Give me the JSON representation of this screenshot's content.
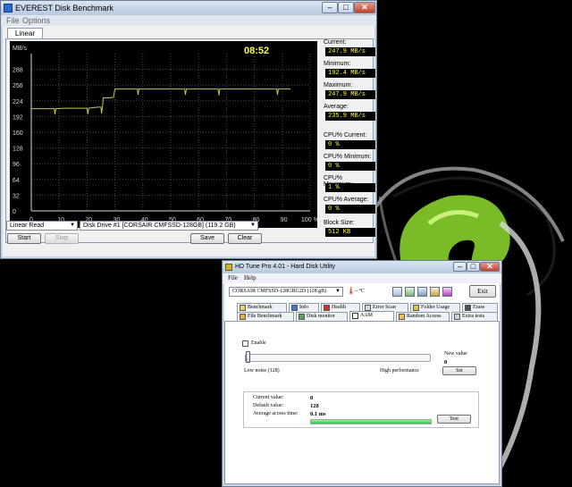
{
  "colors": {
    "desktop": "#000000",
    "chart_bg": "#000000",
    "grid": "#2e5a2e",
    "axis": "#d8d8d8",
    "trace": "#c8c84a",
    "clock": "#ffff40",
    "value_text": "#ffff40",
    "aam_progress": "#2fbf3a",
    "ornament_green": "#7fc62a"
  },
  "everest": {
    "title": "EVEREST Disk Benchmark",
    "menu": [
      "File",
      "Options"
    ],
    "tab": "Linear Read",
    "clock": "08:52",
    "stats": [
      {
        "label": "Current:",
        "value": "247.9 MB/s"
      },
      {
        "label": "Minimum:",
        "value": "192.4 MB/s"
      },
      {
        "label": "Maximum:",
        "value": "247.9 MB/s"
      },
      {
        "label": "Average:",
        "value": "235.9 MB/s"
      },
      {
        "label": "CPU% Current:",
        "value": "0 %"
      },
      {
        "label": "CPU% Minimum:",
        "value": "0 %"
      },
      {
        "label": "CPU% Maximum:",
        "value": "1 %"
      },
      {
        "label": "CPU% Average:",
        "value": "0 %"
      },
      {
        "label": "Block Size:",
        "value": "512 KB"
      }
    ],
    "test_select": "Linear Read",
    "drive_select": "Disk Drive #1  [CORSAIR CMFSSD-128GB]  (119.2 GB)",
    "buttons": {
      "start": "Start",
      "stop": "Stop",
      "save": "Save",
      "clear": "Clear"
    },
    "window_icons": [
      "minimize-icon",
      "maximize-icon",
      "close-icon"
    ]
  },
  "chart_data": {
    "type": "line",
    "title": "",
    "ylabel": "MB/s",
    "xlabel": "",
    "y_ticks": [
      "0",
      "32",
      "64",
      "96",
      "128",
      "160",
      "192",
      "224",
      "256",
      "288"
    ],
    "x_ticks": [
      "0",
      "10",
      "20",
      "30",
      "40",
      "50",
      "60",
      "70",
      "80",
      "90",
      "100 %"
    ],
    "ylim": [
      0,
      320
    ],
    "xlim": [
      0,
      100
    ],
    "grid": true,
    "series": [
      {
        "x": [
          0,
          5,
          8.2,
          8.5,
          8.8,
          12,
          17,
          20,
          20.3,
          20.6,
          22,
          24,
          25,
          25.2,
          25.5,
          25.8,
          26.5,
          28,
          29.5,
          30,
          32,
          35,
          37,
          38,
          38.3,
          38.6,
          45,
          50,
          55,
          55.3,
          55.6,
          60,
          65,
          67,
          67.3,
          67.6,
          75,
          80,
          85,
          88,
          88.3,
          88.6,
          91,
          93
        ],
        "y": [
          208,
          208,
          208,
          196,
          208,
          209,
          209,
          209,
          197,
          209,
          210,
          211,
          211,
          198,
          210,
          230,
          230,
          230,
          231,
          248,
          248,
          248,
          248,
          248,
          236,
          248,
          248,
          248,
          248,
          236,
          248,
          248,
          248,
          248,
          235,
          248,
          248,
          248,
          248,
          248,
          236,
          248,
          248,
          248
        ]
      }
    ]
  },
  "hdtune": {
    "title": "HD Tune Pro 4.01 - Hard Disk Utility",
    "menu": [
      "File",
      "Help"
    ],
    "drive_select": "CORSAIR CMFSSD-128GBG2D (128 gB)",
    "temperature": "– °C",
    "exit": "Exit",
    "toolbar_icons": [
      "copy-icon",
      "save-icon",
      "info-icon",
      "settings-icon",
      "download-icon"
    ],
    "tabs_row1": [
      {
        "label": "Benchmark",
        "icon": "benchmark-icon"
      },
      {
        "label": "Info",
        "icon": "info-icon"
      },
      {
        "label": "Health",
        "icon": "health-icon"
      },
      {
        "label": "Error Scan",
        "icon": "error-scan-icon"
      },
      {
        "label": "Folder Usage",
        "icon": "folder-icon"
      },
      {
        "label": "Erase",
        "icon": "erase-icon"
      }
    ],
    "tabs_row2": [
      {
        "label": "File Benchmark",
        "icon": "file-benchmark-icon"
      },
      {
        "label": "Disk monitor",
        "icon": "monitor-icon"
      },
      {
        "label": "AAM",
        "icon": "speaker-icon"
      },
      {
        "label": "Random Access",
        "icon": "random-access-icon"
      },
      {
        "label": "Extra tests",
        "icon": "extra-tests-icon"
      }
    ],
    "active_tab": "AAM",
    "aam": {
      "enable_label": "Enable",
      "enable_checked": false,
      "new_value_label": "New value",
      "new_value": "0",
      "set_button": "Set",
      "slider_low": "Low noise (128)",
      "slider_high": "High performance",
      "slider_level": 0,
      "current_label": "Current value:",
      "current_value": "0",
      "default_label": "Default value:",
      "default_value": "128",
      "access_label": "Average access time:",
      "access_value": "0.1 ms",
      "test_button": "Test",
      "progress": 1.0
    }
  }
}
